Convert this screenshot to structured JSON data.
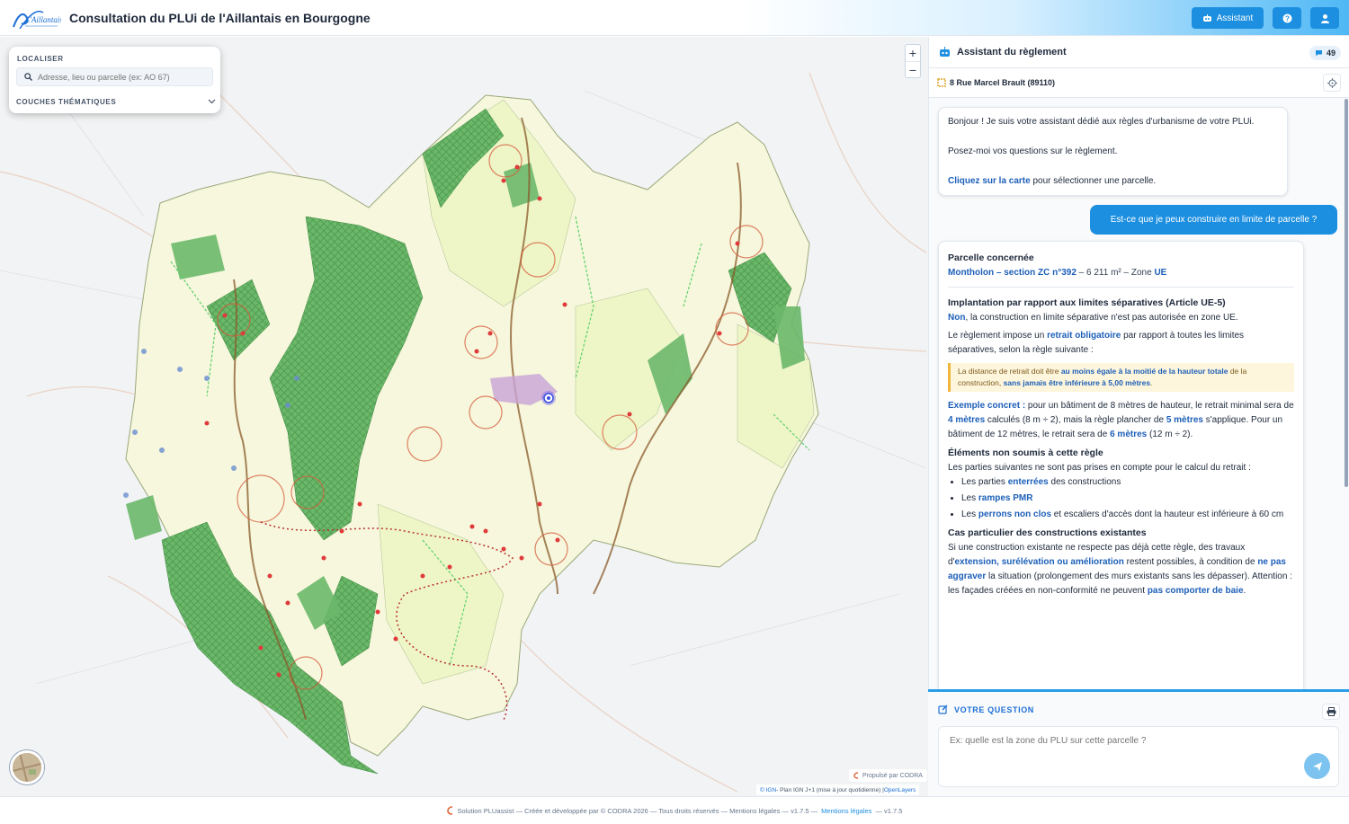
{
  "header": {
    "logo_text": "L'Aillantais",
    "title": "Consultation du PLUi de l'Aillantais en Bourgogne",
    "assistant_button": "Assistant",
    "help_icon": "help-icon",
    "user_icon": "user-icon"
  },
  "localiser": {
    "title": "LOCALISER",
    "search_placeholder": "Adresse, lieu ou parcelle (ex: AO 67)",
    "layers_label": "COUCHES THÉMATIQUES"
  },
  "map": {
    "zoom_in": "+",
    "zoom_out": "−",
    "powered": "Propulsé par CODRA",
    "attribution_ign": "© IGN",
    "attribution_text": " - Plan IGN J+1 (mise à jour quotidienne) | ",
    "attribution_ol": "OpenLayers",
    "colors": {
      "forest": "#6bb86a",
      "agri": "#f6f7dc",
      "urban": "#eef6c8",
      "river": "#8a5a2b",
      "marker": "#e03a3a"
    }
  },
  "assistant": {
    "title": "Assistant du règlement",
    "count": "49",
    "address": "8 Rue Marcel Brault (89110)"
  },
  "messages": {
    "bot1_p1": "Bonjour ! Je suis votre assistant dédié aux règles d'urbanisme de votre PLUi.",
    "bot1_p2": "Posez-moi vos questions sur le règlement.",
    "bot1_link": "Cliquez sur la carte",
    "bot1_p3_rest": " pour sélectionner une parcelle.",
    "user": "Est-ce que je peux construire en limite de parcelle ?",
    "parcel_heading": "Parcelle concernée",
    "parcel_link": "Montholon – section ZC n°392",
    "parcel_rest": " – 6 211 m² – Zone ",
    "parcel_zone": "UE",
    "impl_heading": "Implantation par rapport aux limites séparatives (Article UE-5)",
    "impl_no": "Non",
    "impl_rest": ", la construction en limite séparative n'est pas autorisée en zone UE.",
    "rule_pre": "Le règlement impose un ",
    "rule_bold": "retrait obligatoire",
    "rule_post": " par rapport à toutes les limites séparatives, selon la règle suivante :",
    "note_1": "La distance de retrait doit être ",
    "note_b1": "au moins égale à la moitié de la hauteur totale",
    "note_2": " de la construction, ",
    "note_b2": "sans jamais être inférieure à 5,00 mètres",
    "note_3": ".",
    "ex_label": "Exemple concret :",
    "ex_1": " pour un bâtiment de 8 mètres de hauteur, le retrait minimal sera de ",
    "ex_b1": "4 mètres",
    "ex_2": " calculés (8 m ÷ 2), mais la règle plancher de ",
    "ex_b2": "5 mètres",
    "ex_3": " s'applique. Pour un bâtiment de 12 mètres, le retrait sera de ",
    "ex_b3": "6 mètres",
    "ex_4": " (12 m ÷ 2).",
    "elem_heading": "Éléments non soumis à cette règle",
    "elem_intro": "Les parties suivantes ne sont pas prises en compte pour le calcul du retrait :",
    "li1_pre": "Les parties ",
    "li1_b": "enterrées",
    "li1_post": " des constructions",
    "li2_pre": "Les ",
    "li2_b": "rampes PMR",
    "li3_pre": "Les ",
    "li3_b": "perrons non clos",
    "li3_post": " et escaliers d'accès dont la hauteur est inférieure à 60 cm",
    "cas_heading": "Cas particulier des constructions existantes",
    "cas_1": "Si une construction existante ne respecte pas déjà cette règle, des travaux d'",
    "cas_b1": "extension, surélévation ou amélioration",
    "cas_2": " restent possibles, à condition de ",
    "cas_b2": "ne pas aggraver",
    "cas_3": " la situation (prolongement des murs existants sans les dépasser). Attention : les façades créées en non-conformité ne peuvent ",
    "cas_b3": "pas comporter de baie",
    "cas_4": "."
  },
  "question": {
    "title": "VOTRE QUESTION",
    "placeholder": "Ex: quelle est la zone du PLU sur cette parcelle ?"
  },
  "footer": {
    "text": "Solution PLUassist — Créée et développée par © CODRA 2026 — Tous droits réservés — Mentions légales — v1.7.5 —",
    "link": "Mentions légales",
    "version": "— v1.7.5"
  }
}
